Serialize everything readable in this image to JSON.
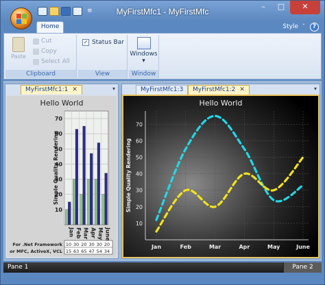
{
  "window": {
    "title": "MyFirstMfc1 - MyFirstMfc",
    "min_glyph": "–",
    "max_glyph": "□",
    "close_glyph": "✕"
  },
  "qat": {
    "separator": "≡"
  },
  "ribbon": {
    "tabs": [
      {
        "label": "Home"
      }
    ],
    "style_label": "Style",
    "style_chevron": "˅",
    "help_glyph": "?",
    "clipboard": {
      "label": "Clipboard",
      "paste": "Paste",
      "cut": "Cut",
      "copy": "Copy",
      "select_all": "Select All"
    },
    "view": {
      "label": "View",
      "status_bar": "Status Bar",
      "status_bar_checked": "✓"
    },
    "window_group": {
      "label": "Window",
      "windows": "Windows",
      "arrow": "▾"
    }
  },
  "left_pane": {
    "tabs": [
      {
        "label": "MyFirstMfc1:1",
        "active": true
      }
    ],
    "close_glyph": "✕",
    "menu_arrow": "▾"
  },
  "right_pane": {
    "tabs": [
      {
        "label": "MyFirstMfc1:3",
        "active": false
      },
      {
        "label": "MyFirstMfc1:2",
        "active": true
      }
    ],
    "close_glyph": "✕",
    "menu_arrow": "▾"
  },
  "status": {
    "pane1": "Pane 1",
    "pane2": "Pane 2"
  },
  "chart_data": [
    {
      "type": "bar",
      "title": "Hello World",
      "ylabel": "Simple Quality Rendering",
      "categories": [
        "Jan",
        "Feb",
        "Mar",
        "Apr",
        "May",
        "June"
      ],
      "ylim": [
        0,
        75
      ],
      "yticks": [
        10,
        20,
        30,
        40,
        50,
        60,
        70
      ],
      "series": [
        {
          "name": "For .Net Framework",
          "values": [
            10,
            30,
            20,
            30,
            30,
            20
          ],
          "color": "#8fbf8f"
        },
        {
          "name": "or MFC, ActiveX, VCL",
          "values": [
            15,
            63,
            65,
            47,
            54,
            34
          ],
          "color": "#2a2d8c"
        }
      ],
      "grid": true
    },
    {
      "type": "line",
      "title": "Hello World",
      "ylabel": "Simple Quality Rendering",
      "categories": [
        "Jan",
        "Feb",
        "Mar",
        "Apr",
        "May",
        "June"
      ],
      "ylim": [
        0,
        78
      ],
      "yticks": [
        10,
        20,
        30,
        40,
        50,
        60,
        70
      ],
      "series": [
        {
          "values": [
            12,
            55,
            75,
            55,
            24,
            33
          ],
          "color": "#22d8e8",
          "style": "dashed"
        },
        {
          "values": [
            5,
            30,
            20,
            40,
            30,
            50
          ],
          "color": "#f2e21c",
          "style": "dashed"
        }
      ],
      "background": "dark",
      "grid": true
    }
  ]
}
